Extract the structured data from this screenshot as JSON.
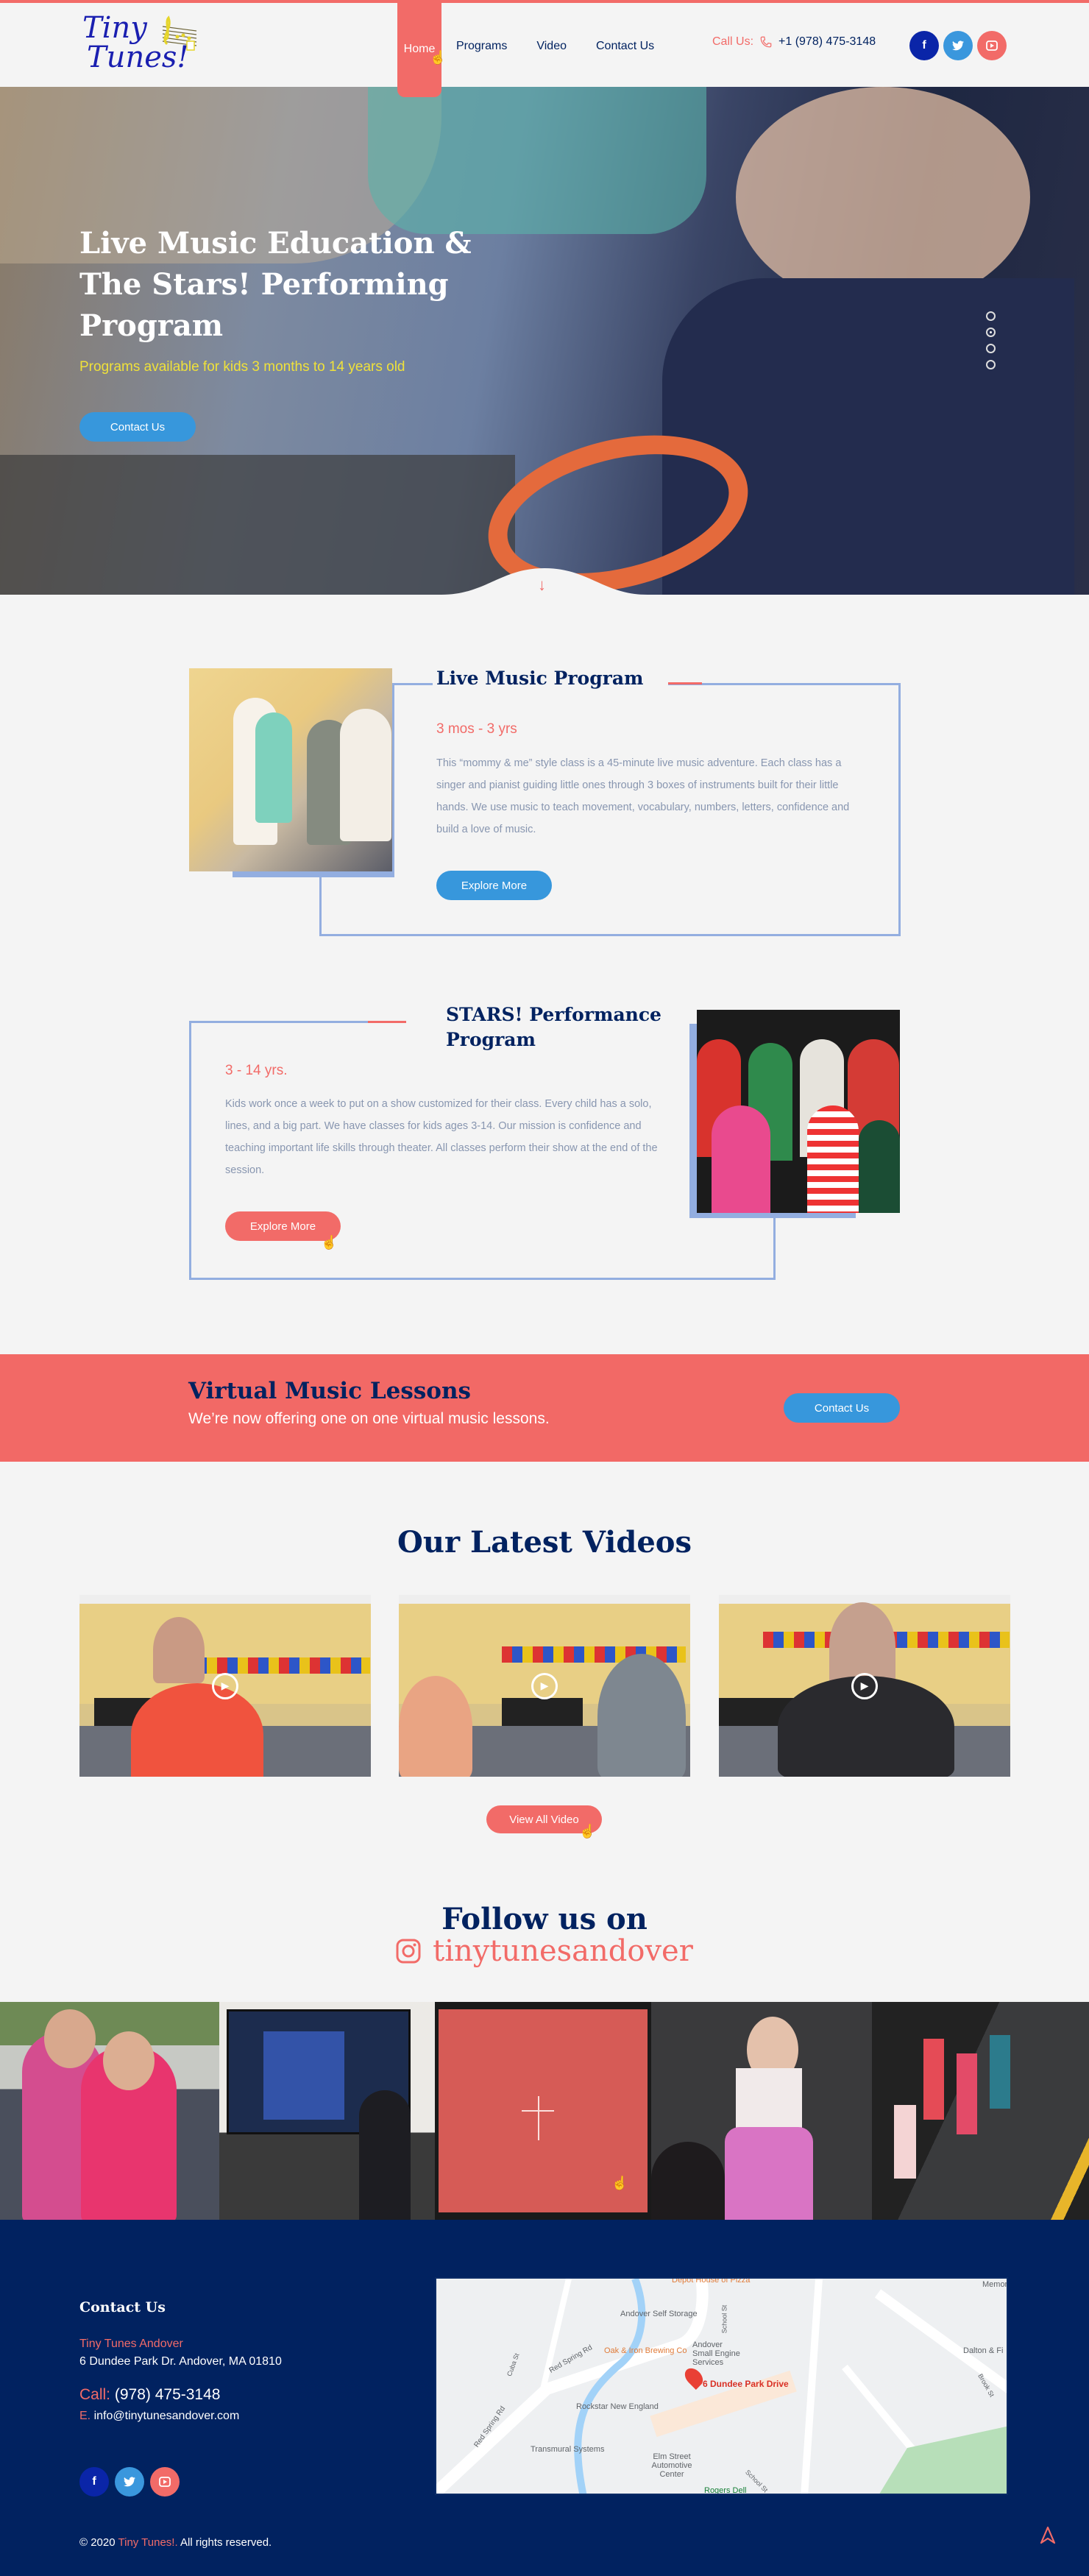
{
  "header": {
    "logo": {
      "line1": "Tiny",
      "line2": "Tunes!"
    },
    "nav": [
      {
        "label": "Home",
        "active": true
      },
      {
        "label": "Programs",
        "active": false
      },
      {
        "label": "Video",
        "active": false
      },
      {
        "label": "Contact Us",
        "active": false
      }
    ],
    "call_label": "Call Us:",
    "phone": "+1 (978) 475-3148",
    "social": [
      {
        "name": "facebook",
        "glyph": "f",
        "color": "#0a25a8"
      },
      {
        "name": "twitter",
        "glyph": "t",
        "color": "#3a97dd"
      },
      {
        "name": "youtube",
        "glyph": "▶",
        "color": "#f26b68"
      }
    ]
  },
  "hero": {
    "title": "Live Music Education & The Stars! Performing Program",
    "subtitle": "Programs available for kids 3 months to 14 years old",
    "button": "Contact Us",
    "slides_total": 4,
    "slide_active": 2,
    "scroll_icon": "↓"
  },
  "programs": [
    {
      "title": "Live Music Program",
      "age": "3 mos - 3 yrs",
      "description": "This “mommy & me” style class is a 45-minute live music adventure. Each class has a singer and pianist guiding little ones through 3 boxes of instruments built for their little hands. We use music to teach movement, vocabulary, numbers, letters, confidence and build a love of music.",
      "button": "Explore More"
    },
    {
      "title": "STARS! Performance Program",
      "age": "3 - 14 yrs.",
      "description": "Kids work once a week to put on a show customized for their class. Every child has a solo, lines, and a big part. We have classes for kids ages 3-14. Our mission is confidence and teaching important life skills through theater. All classes perform their show at the end of the session.",
      "button": "Explore More"
    }
  ],
  "cta": {
    "title": "Virtual Music Lessons",
    "subtitle": "We’re now offering one on one virtual music lessons.",
    "button": "Contact Us"
  },
  "videos": {
    "title": "Our Latest Videos",
    "items": [
      {
        "label": "video-1"
      },
      {
        "label": "video-2"
      },
      {
        "label": "video-3"
      }
    ],
    "button": "View All Video"
  },
  "instagram": {
    "title": "Follow us on",
    "handle": "tinytunesandover"
  },
  "footer": {
    "title": "Contact Us",
    "business": "Tiny Tunes Andover",
    "address": "6 Dundee Park Dr. Andover, MA 01810",
    "call_label": "Call:",
    "phone": "(978) 475-3148",
    "email_label": "E.",
    "email": "info@tinytunesandover.com",
    "copyright_pre": "© 2020",
    "copyright_brand": "Tiny Tunes!.",
    "copyright_post": "All rights reserved."
  },
  "map": {
    "pin_label": "6 Dundee Park Drive",
    "places": [
      "Depot House of Pizza",
      "Andover Self Storage",
      "Oak & Iron Brewing Co",
      "Andover Small Engine Services",
      "Rockstar New England",
      "Transmural Systems",
      "Elm Street Automotive Center",
      "Rogers Dell",
      "Dalton & Fi",
      "Memor"
    ],
    "streets": [
      "Red Spring Rd",
      "Red Spring Rd",
      "Cuba St",
      "School St",
      "School St",
      "Brook St"
    ]
  },
  "colors": {
    "accent": "#f26b68",
    "navy": "#012260",
    "blue": "#3797dc",
    "frame": "#93aee0",
    "yellow": "#efe13a"
  }
}
